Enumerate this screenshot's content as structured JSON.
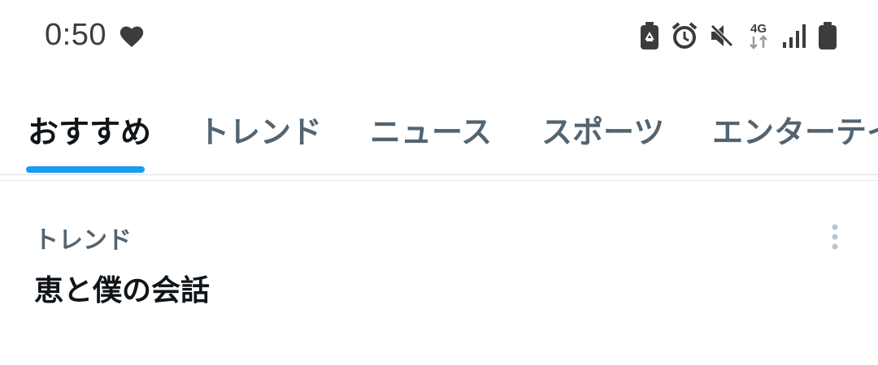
{
  "status_bar": {
    "time": "0:50",
    "network_label": "4G",
    "icons": [
      "heart-icon",
      "battery-saver-icon",
      "alarm-icon",
      "mute-icon",
      "4g-data-icon",
      "signal-icon",
      "battery-icon"
    ]
  },
  "tabs": [
    {
      "label": "おすすめ",
      "active": true
    },
    {
      "label": "トレンド",
      "active": false
    },
    {
      "label": "ニュース",
      "active": false
    },
    {
      "label": "スポーツ",
      "active": false
    },
    {
      "label": "エンターテイ",
      "active": false
    }
  ],
  "trend": {
    "category": "トレンド",
    "title": "恵と僕の会話"
  },
  "colors": {
    "accent": "#1d9bf0",
    "primary_text": "#0f1419",
    "secondary_text": "#536471",
    "status_icon": "#3c3c3c"
  }
}
